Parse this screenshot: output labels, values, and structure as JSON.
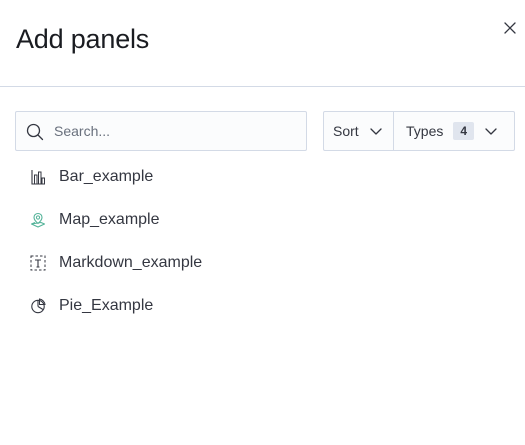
{
  "flyout": {
    "title": "Add panels"
  },
  "search": {
    "placeholder": "Search..."
  },
  "filters": {
    "sort_label": "Sort",
    "types_label": "Types",
    "types_count": "4"
  },
  "panels": [
    {
      "label": "Bar_example",
      "icon": "bar-chart-icon"
    },
    {
      "label": "Map_example",
      "icon": "map-icon"
    },
    {
      "label": "Markdown_example",
      "icon": "markdown-icon"
    },
    {
      "label": "Pie_Example",
      "icon": "pie-chart-icon"
    }
  ],
  "colors": {
    "map_icon": "#54b399",
    "border": "#d3dae6",
    "text": "#343741"
  }
}
